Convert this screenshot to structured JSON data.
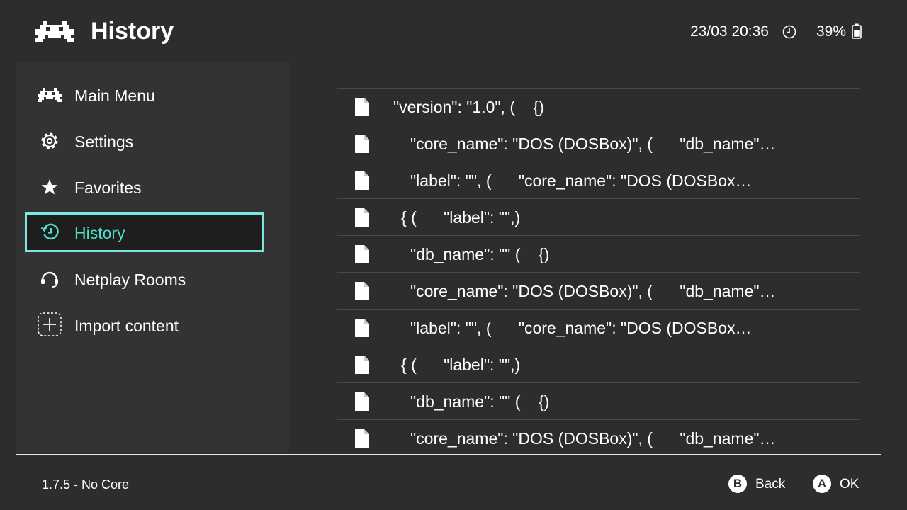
{
  "header": {
    "title": "History",
    "clock": "23/03 20:36",
    "battery": "39%"
  },
  "sidebar": {
    "items": [
      {
        "label": "Main Menu",
        "icon": "retroarch-invader-icon"
      },
      {
        "label": "Settings",
        "icon": "gear-icon"
      },
      {
        "label": "Favorites",
        "icon": "star-icon"
      },
      {
        "label": "History",
        "icon": "history-icon",
        "selected": true
      },
      {
        "label": "Netplay Rooms",
        "icon": "headset-icon"
      },
      {
        "label": "Import content",
        "icon": "plus-icon"
      }
    ]
  },
  "content": {
    "rows": [
      {
        "text": "\"version\": \"1.0\", (    {)",
        "indent": 1
      },
      {
        "text": "\"core_name\": \"DOS (DOSBox)\", (      \"db_name\"…",
        "indent": 3
      },
      {
        "text": "\"label\": \"\", (      \"core_name\": \"DOS (DOSBox…",
        "indent": 3
      },
      {
        "text": "{ (      \"label\": \"\",)",
        "indent": 2
      },
      {
        "text": "\"db_name\": \"\" (    {)",
        "indent": 3
      },
      {
        "text": "\"core_name\": \"DOS (DOSBox)\", (      \"db_name\"…",
        "indent": 3
      },
      {
        "text": "\"label\": \"\", (      \"core_name\": \"DOS (DOSBox…",
        "indent": 3
      },
      {
        "text": "{ (      \"label\": \"\",)",
        "indent": 2
      },
      {
        "text": "\"db_name\": \"\" (    {)",
        "indent": 3
      },
      {
        "text": "\"core_name\": \"DOS (DOSBox)\", (      \"db_name\"…",
        "indent": 3
      }
    ]
  },
  "footer": {
    "version": "1.7.5 - No Core",
    "back_key": "B",
    "back_label": "Back",
    "ok_key": "A",
    "ok_label": "OK"
  },
  "colors": {
    "background": "#2d2d2d",
    "sidebar": "#333333",
    "accent": "#4ee0c8",
    "selection_border": "#7ee5df"
  }
}
